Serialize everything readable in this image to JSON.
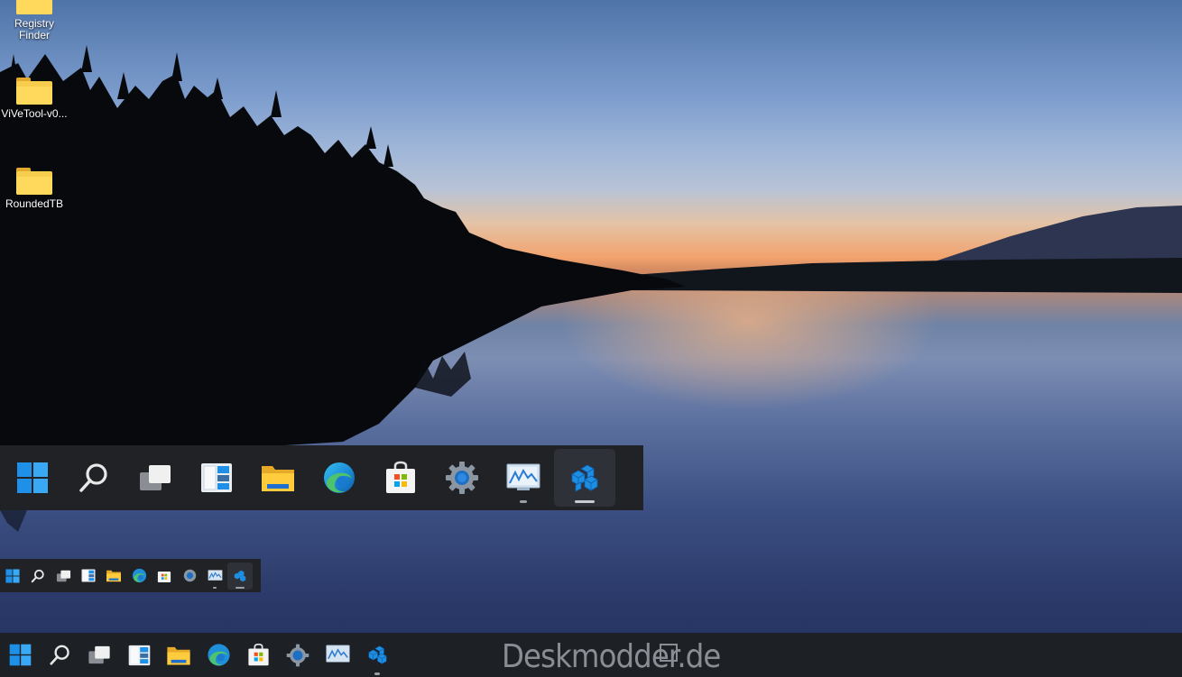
{
  "desktop": {
    "icons": [
      {
        "label": "Registry Finder"
      },
      {
        "label": "ViVeTool-v0..."
      },
      {
        "label": "RoundedTB"
      }
    ]
  },
  "taskbar_icons": [
    {
      "name": "start-icon",
      "label": "Start"
    },
    {
      "name": "search-icon",
      "label": "Search"
    },
    {
      "name": "task-view-icon",
      "label": "Task View"
    },
    {
      "name": "widgets-icon",
      "label": "Widgets"
    },
    {
      "name": "file-explorer-icon",
      "label": "File Explorer"
    },
    {
      "name": "edge-icon",
      "label": "Microsoft Edge"
    },
    {
      "name": "store-icon",
      "label": "Microsoft Store"
    },
    {
      "name": "settings-icon",
      "label": "Settings"
    },
    {
      "name": "performance-monitor-icon",
      "label": "Performance Monitor"
    },
    {
      "name": "registry-editor-icon",
      "label": "Registry Editor"
    }
  ],
  "watermark": "Deskmodder.de",
  "colors": {
    "taskbar": "#202226",
    "accent": "#1e90e8",
    "folder": "#f7cd4e"
  }
}
